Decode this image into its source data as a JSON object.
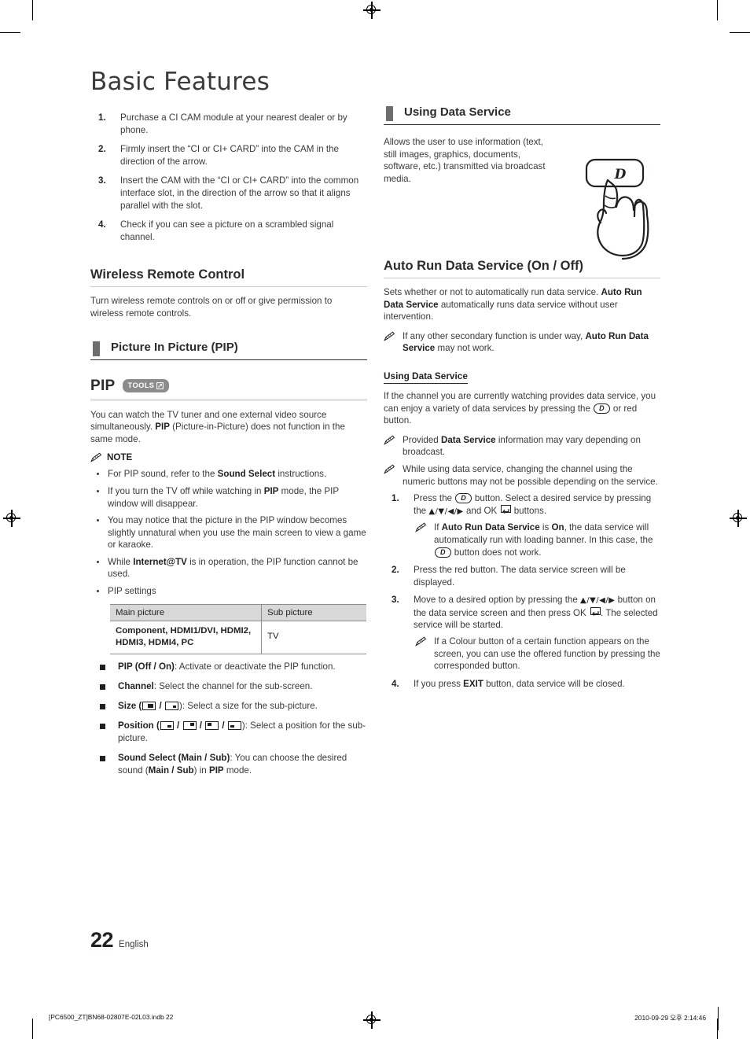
{
  "document": {
    "title": "Basic Features",
    "page_number": "22",
    "language": "English",
    "print_file": "[PC6500_ZT]BN68-02807E-02L03.indb   22",
    "print_timestamp": "2010-09-29   오후 2:14:46"
  },
  "left_column": {
    "steps": [
      {
        "n": "1.",
        "text": "Purchase a CI CAM module at your nearest dealer or by phone."
      },
      {
        "n": "2.",
        "text": "Firmly insert the “CI or CI+ CARD” into the CAM in the direction of the arrow."
      },
      {
        "n": "3.",
        "text": "Insert the CAM with the “CI or CI+ CARD” into the common interface slot, in the direction of the arrow so that it aligns parallel with the slot."
      },
      {
        "n": "4.",
        "text": "Check if you can see a picture on a scrambled signal channel."
      }
    ],
    "wireless": {
      "heading": "Wireless Remote Control",
      "body": "Turn wireless remote controls on or off or give permission to wireless remote controls."
    },
    "pip_section_heading": "Picture In Picture (PIP)",
    "pip": {
      "label": "PIP",
      "tools_badge": "TOOLS",
      "intro_1": "You can watch the TV tuner and one external video source simultaneously. ",
      "intro_bold": "PIP",
      "intro_2": " (Picture-in-Picture) does not function in the same mode.",
      "note_title": "NOTE",
      "notes": [
        {
          "pre": "For PIP sound, refer to the ",
          "bold": "Sound Select",
          "post": " instructions."
        },
        {
          "pre": "If you turn the TV off while watching in ",
          "bold": "PIP",
          "post": " mode, the PIP window will disappear."
        },
        {
          "pre": "You may notice that the picture in the PIP window becomes slightly unnatural when you use the main screen to view a game or karaoke.",
          "bold": "",
          "post": ""
        },
        {
          "pre": "While ",
          "bold": "Internet@TV",
          "post": " is in operation, the PIP function cannot be used."
        },
        {
          "pre": "PIP settings",
          "bold": "",
          "post": ""
        }
      ],
      "table": {
        "headers": [
          "Main picture",
          "Sub picture"
        ],
        "rows": [
          {
            "main": "Component, HDMI1/DVI, HDMI2, HDMI3, HDMI4, PC",
            "sub": "TV"
          }
        ]
      },
      "options": [
        {
          "bold": "PIP (Off / On)",
          "rest": ": Activate or deactivate the PIP function."
        },
        {
          "bold": "Channel",
          "rest": ": Select the channel for the sub-screen."
        },
        {
          "bold": "Size",
          "rest": "): Select a size for the sub-picture.",
          "icons": "size"
        },
        {
          "bold": "Position",
          "rest": "): Select a position for the sub-picture.",
          "icons": "position"
        },
        {
          "bold": "Sound Select (Main / Sub)",
          "rest": ": You can choose the desired sound (",
          "bold2": "Main / Sub",
          "rest2": ") in ",
          "bold3": "PIP",
          "rest3": " mode."
        }
      ]
    }
  },
  "right_column": {
    "using_data_service_heading": "Using Data Service",
    "using_data_service_body": "Allows the user to use information (text, still images, graphics, documents, software, etc.) transmitted via broadcast media.",
    "auto_run": {
      "heading": "Auto Run Data Service (On / Off)",
      "body_1": "Sets whether or not to automatically run data service. ",
      "body_bold": "Auto Run Data Service",
      "body_2": " automatically runs data service without user intervention.",
      "note_1_pre": "If any other secondary function is under way, ",
      "note_1_bold": "Auto Run Data Service",
      "note_1_post": " may not work."
    },
    "using": {
      "mini_heading": "Using Data Service",
      "intro_1": "If the channel you are currently watching provides data service, you can enjoy a variety of data services by pressing the ",
      "intro_2": " or red button.",
      "note_a_pre": "Provided ",
      "note_a_bold": "Data Service",
      "note_a_post": " information may vary depending on broadcast.",
      "note_b": "While using data service, changing the channel using the numeric buttons may not be possible depending on the service.",
      "steps": [
        {
          "n": "1.",
          "seg1": "Press the ",
          "seg2": " button. Select a desired service by pressing the ",
          "arrows": "▲/▼/◀/▶",
          "seg3": " and OK ",
          "seg4": " buttons.",
          "note_pre": "If ",
          "note_bold1": "Auto Run Data Service",
          "note_mid": " is ",
          "note_bold2": "On",
          "note_post": ", the data service will automatically run with loading banner. In this case, the ",
          "note_end": " button does not work."
        },
        {
          "n": "2.",
          "text": "Press the red button. The data service screen will be displayed."
        },
        {
          "n": "3.",
          "seg1": "Move to a desired option by pressing the ",
          "arrows": "▲/▼/◀/▶",
          "seg2": " button on the data service screen and then press OK ",
          "seg3": ". The selected service will be started.",
          "note": "If a Colour button of a certain function appears on the screen, you can use the offered function by pressing the corresponded button."
        },
        {
          "n": "4.",
          "pre": "If you press ",
          "bold": "EXIT",
          "post": " button, data service will be closed."
        }
      ]
    }
  },
  "icons": {
    "d_button": "D",
    "pencil": "pencil-icon",
    "registration_mark": "registration-target",
    "hand": "hand-pressing-button-illustration"
  },
  "colors": {
    "text": "#3a3a3a",
    "heading": "#2b2b2b",
    "bar": "#6e6e6e",
    "badge": "#8c8c8c",
    "table_header": "#d8d8d8"
  }
}
